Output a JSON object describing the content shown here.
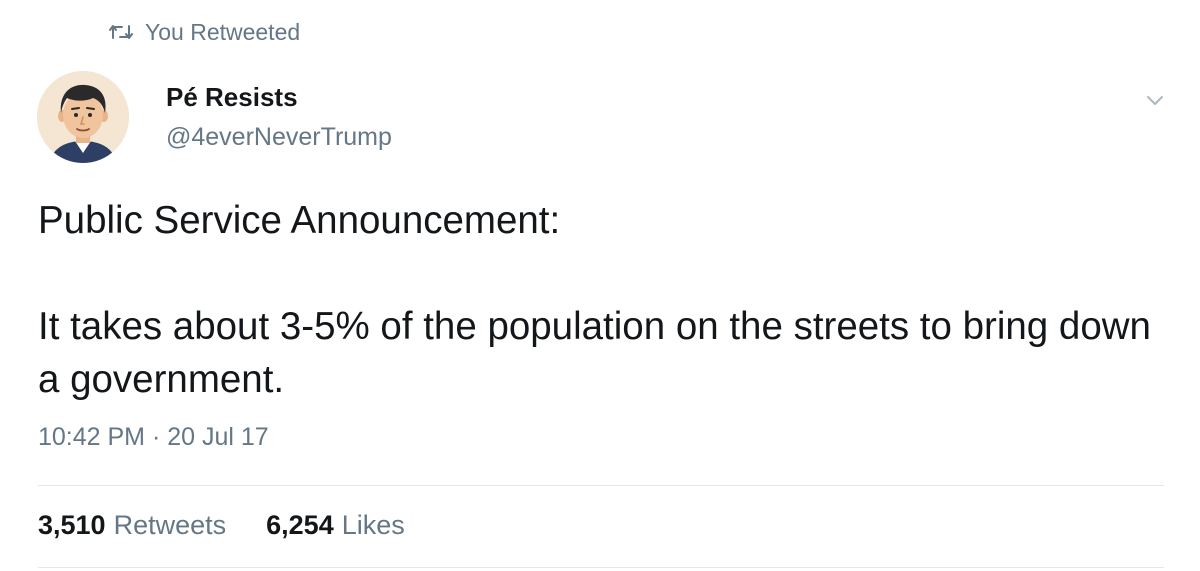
{
  "retweet_context": {
    "icon": "retweet-icon",
    "label": "You Retweeted"
  },
  "author": {
    "display_name": "Pé Resists",
    "handle": "@4everNeverTrump",
    "avatar": "cartoon-man-avatar"
  },
  "tweet": {
    "lines": [
      "Public Service Announcement:",
      "It takes about 3-5% of the population on the streets to bring down a government."
    ],
    "time": "10:42 PM",
    "separator": "·",
    "date": "20 Jul 17"
  },
  "stats": {
    "retweets_count": "3,510",
    "retweets_label": "Retweets",
    "likes_count": "6,254",
    "likes_label": "Likes"
  },
  "menu_icon": "chevron-down-icon",
  "colors": {
    "text": "#14171a",
    "secondary": "#657786",
    "divider": "#e1e8ed",
    "background": "#ffffff"
  }
}
